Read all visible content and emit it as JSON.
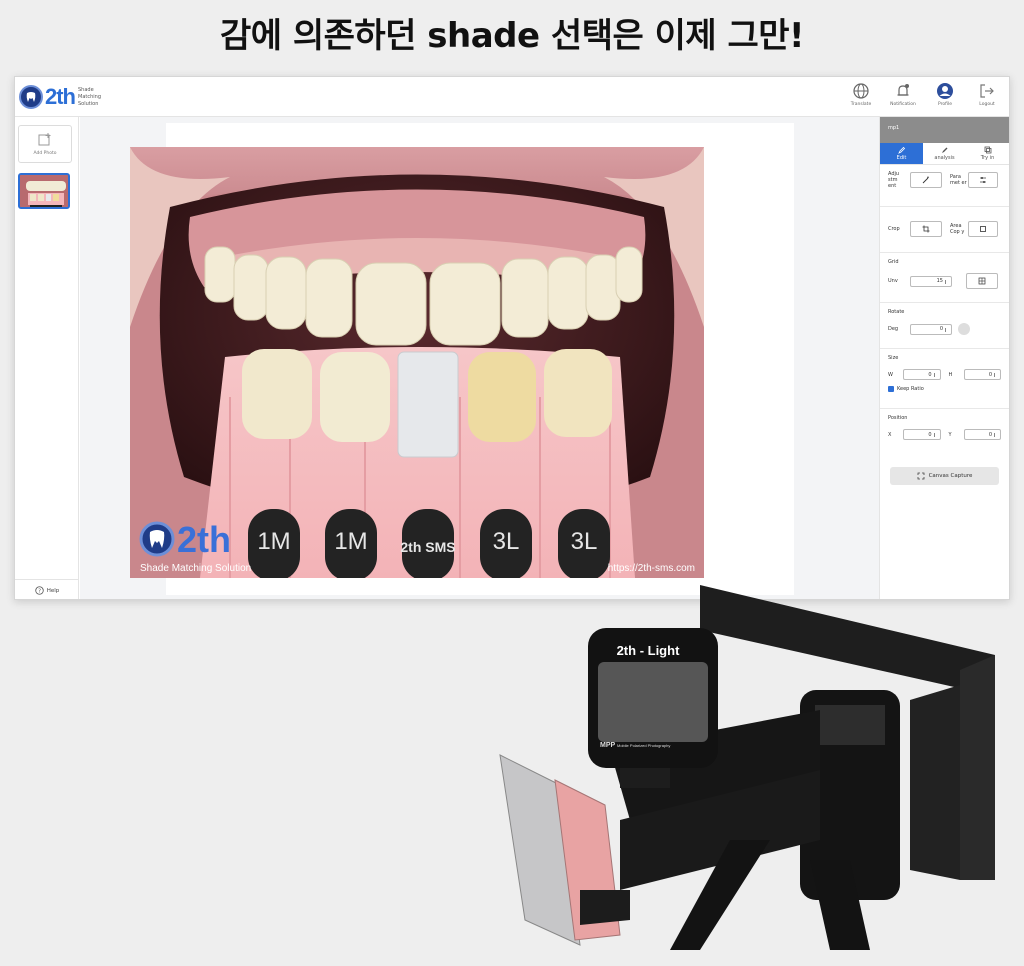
{
  "headline": "감에 의존하던 shade 선택은 이제 그만!",
  "app": {
    "logo": {
      "text": "2th",
      "sub_line1": "Shade",
      "sub_line2": "Matching",
      "sub_line3": "Solution"
    },
    "top_actions": [
      {
        "label": "Translate",
        "icon": "globe-icon"
      },
      {
        "label": "Notification",
        "icon": "bell-icon"
      },
      {
        "label": "Profile",
        "icon": "user-icon"
      },
      {
        "label": "Logout",
        "icon": "logout-icon"
      }
    ],
    "left": {
      "add_photo": "Add Photo",
      "help": "Help"
    },
    "photo": {
      "watermark_logo": "2th",
      "watermark_sub": "Shade Matching Solution",
      "url": "https://2th-sms.com",
      "tab_labels": [
        "1M",
        "1M",
        "2th SMS",
        "3L",
        "3L"
      ]
    },
    "right_panel": {
      "header": "mp1",
      "tabs": [
        {
          "label": "Edit",
          "icon": "edit-icon",
          "active": true
        },
        {
          "label": "analysis",
          "icon": "pen-icon",
          "active": false
        },
        {
          "label": "Try in",
          "icon": "layers-icon",
          "active": false
        }
      ],
      "adjustment_label": "Adju stm ent",
      "parameter_label": "Para met er",
      "crop_label": "Crop",
      "area_copy_label": "Area Cop y",
      "grid_title": "Grid",
      "grid_unit_label": "Unv",
      "grid_value": "15",
      "rotate_title": "Rotate",
      "rotate_deg_label": "Deg",
      "rotate_value": "0",
      "size_title": "Size",
      "size_w_label": "W",
      "size_w_value": "0",
      "size_h_label": "H",
      "size_h_value": "0",
      "keep_ratio_label": "Keep Ratio",
      "position_title": "Position",
      "position_x_label": "X",
      "position_x_value": "0",
      "position_y_label": "Y",
      "position_y_value": "0",
      "capture_label": "Canvas Capture"
    }
  },
  "device": {
    "light_label": "2th - Light",
    "mpp_label": "MPP",
    "mpp_sub": "Mobile Polarized Photography"
  }
}
